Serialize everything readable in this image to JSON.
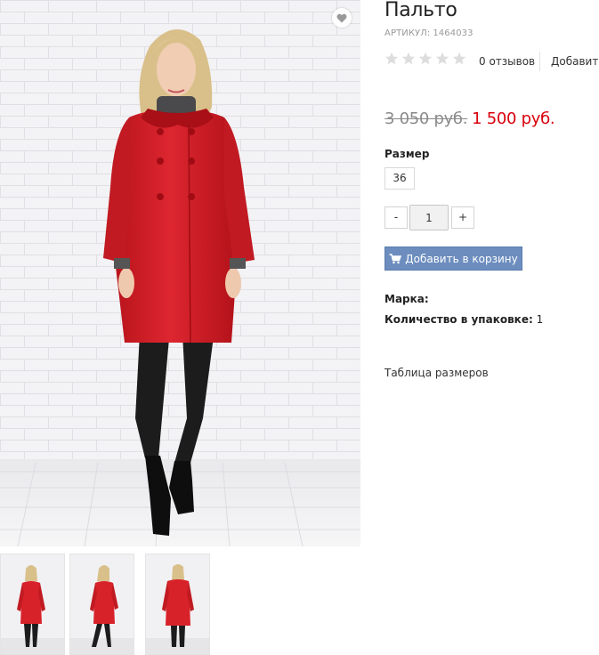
{
  "product": {
    "title": "Пальто",
    "sku_label": "АРТИКУЛ:",
    "sku_value": "1464033",
    "image_alt": "Женщина в красном пальто",
    "wishlist_icon": "heart-icon"
  },
  "rating": {
    "stars_total": 5,
    "stars_filled": 0,
    "reviews_text": "0 отзывов",
    "add_review_label": "Добавить"
  },
  "price": {
    "old": "3 050 руб.",
    "current": "1 500 руб."
  },
  "size": {
    "label": "Размер",
    "options": [
      "36"
    ]
  },
  "quantity": {
    "minus_label": "-",
    "value": "1",
    "plus_label": "+"
  },
  "cart": {
    "label": "Добавить в корзину",
    "icon": "cart-icon"
  },
  "properties": {
    "brand_label": "Марка:",
    "brand_value": "",
    "pack_label": "Количество в упаковке:",
    "pack_value": "1"
  },
  "size_chart_link": "Таблица размеров",
  "thumbnails": [
    "front view",
    "side view",
    "back view"
  ],
  "colors": {
    "price_red": "#d9000c",
    "button_blue": "#6c8dbe",
    "coat_red": "#d8222a",
    "star_grey": "#dddddd"
  }
}
